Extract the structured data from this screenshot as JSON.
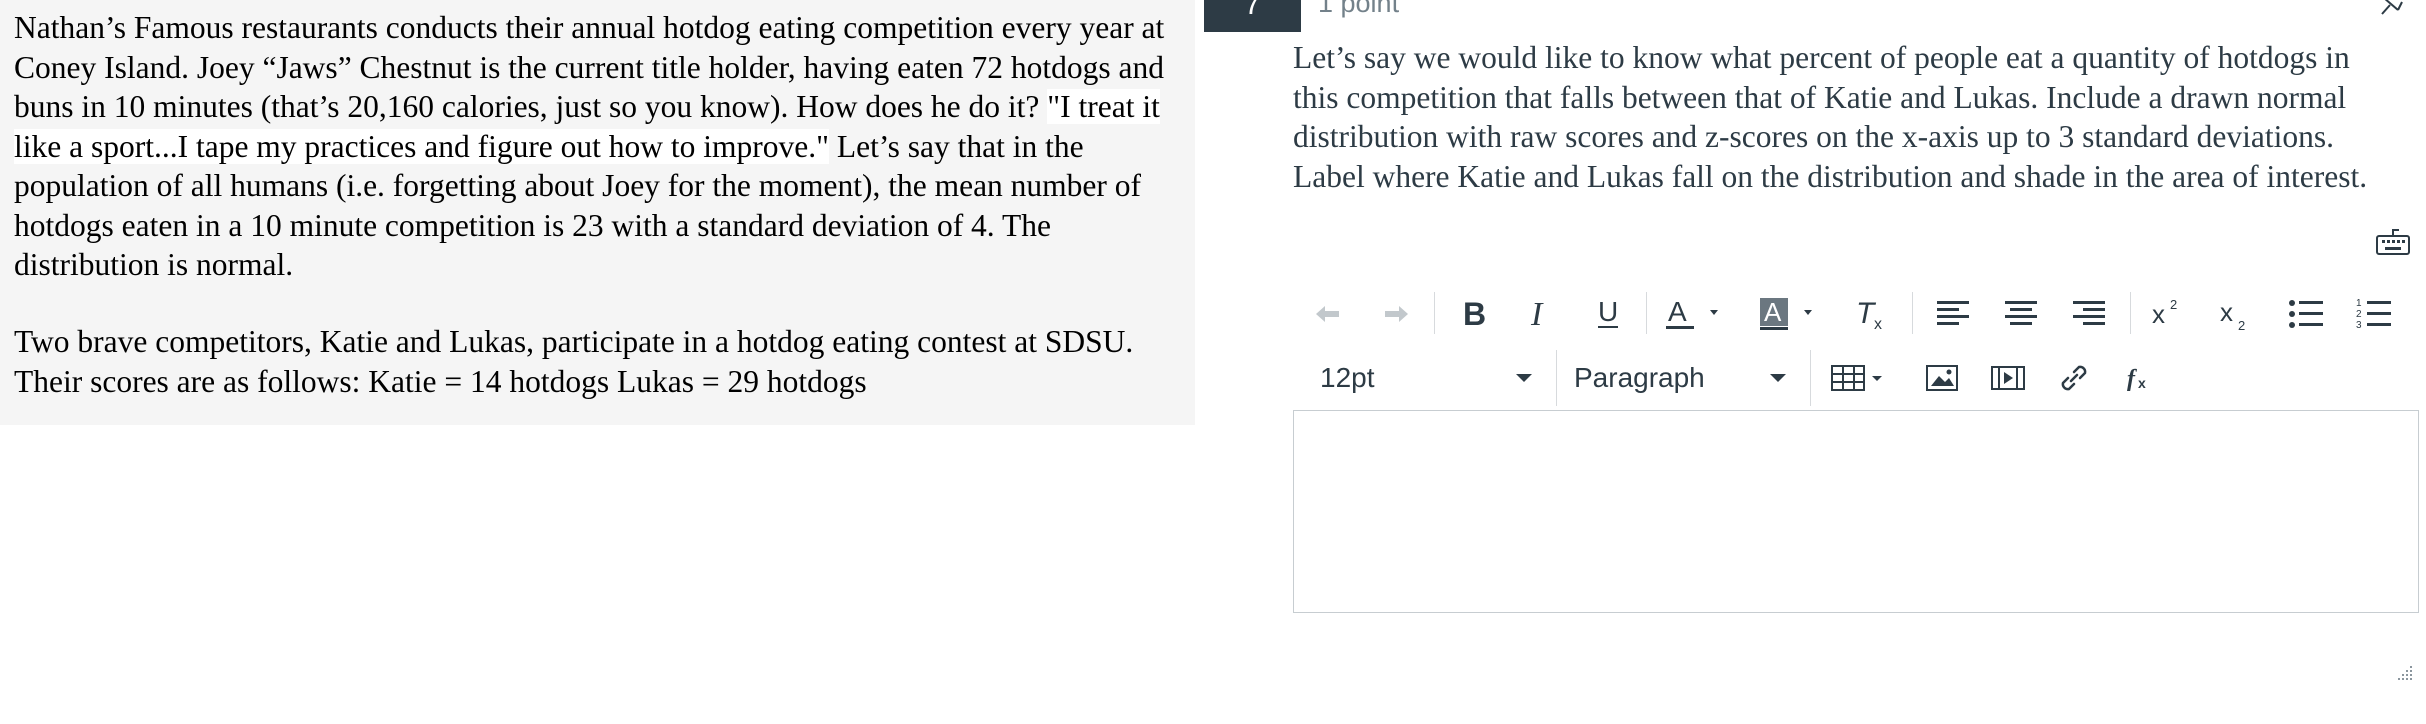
{
  "passage": {
    "paragraph1_before": "Nathan’s Famous restaurants conducts their annual hotdog eating competition every year at Coney Island.  Joey “Jaws” Chestnut is the current title holder, having eaten 72 hotdogs and buns in 10 minutes (that’s 20,160 calories, just so you know).  How does he do it?  ",
    "paragraph1_quote": "\"I treat it like a sport...I tape my practices and figure out how to improve.\"",
    "paragraph1_after": " Let’s say that in the population of all humans (i.e. forgetting about Joey for the moment), the mean number of hotdogs eaten in a 10 minute competition is 23 with a standard deviation of 4. The distribution is normal.",
    "paragraph2": "Two brave competitors, Katie and Lukas, participate in a hotdog eating contest at SDSU.  Their scores are as follows:  Katie = 14 hotdogs   Lukas = 29 hotdogs"
  },
  "question": {
    "number": "7",
    "points": "1 point",
    "text": "Let’s say we would like to know what percent of people eat a quantity of hotdogs in this competition that falls between that of Katie and Lukas.  Include a drawn normal distribution with raw scores and z-scores on the x-axis up to 3 standard deviations.  Label where Katie and Lukas fall on the distribution and shade in the area of interest."
  },
  "toolbar": {
    "font_size": "12pt",
    "block_format": "Paragraph",
    "icons": [
      "undo-icon",
      "redo-icon",
      "bold-icon",
      "italic-icon",
      "underline-icon",
      "text-color-icon",
      "background-color-icon",
      "clear-formatting-icon",
      "align-left-icon",
      "align-center-icon",
      "align-right-icon",
      "superscript-icon",
      "subscript-icon",
      "bullet-list-icon",
      "numbered-list-icon",
      "table-icon",
      "image-icon",
      "media-icon",
      "link-icon",
      "equation-icon",
      "keyboard-icon"
    ]
  },
  "colors": {
    "passage_bg": "#f5f5f5",
    "question_text": "#2d3b45",
    "icon": "#2d3b45",
    "icon_disabled": "#a5afb5",
    "number_badge": "#2d3b45",
    "border": "#c7cdd1"
  },
  "editor": {
    "value": ""
  }
}
